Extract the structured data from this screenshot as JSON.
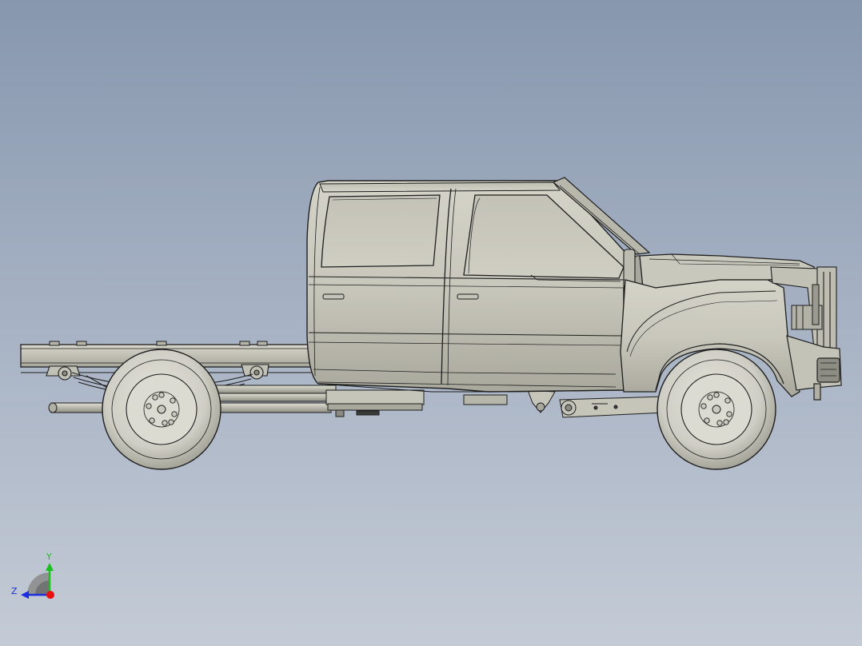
{
  "viewport": {
    "background_top": "#8797ae",
    "background_bottom": "#c4cbd6"
  },
  "model": {
    "body_color": "#c9c8bd",
    "edge_color": "#1f1f1f",
    "tire_color": "#d2d1c8",
    "view": "right side"
  },
  "triad": {
    "y_label": "Y",
    "z_label": "Z",
    "y_color": "#19c01e",
    "z_color": "#1a2ee0",
    "x_color": "#e81010",
    "quadrant_color": "#8a8a8a"
  }
}
